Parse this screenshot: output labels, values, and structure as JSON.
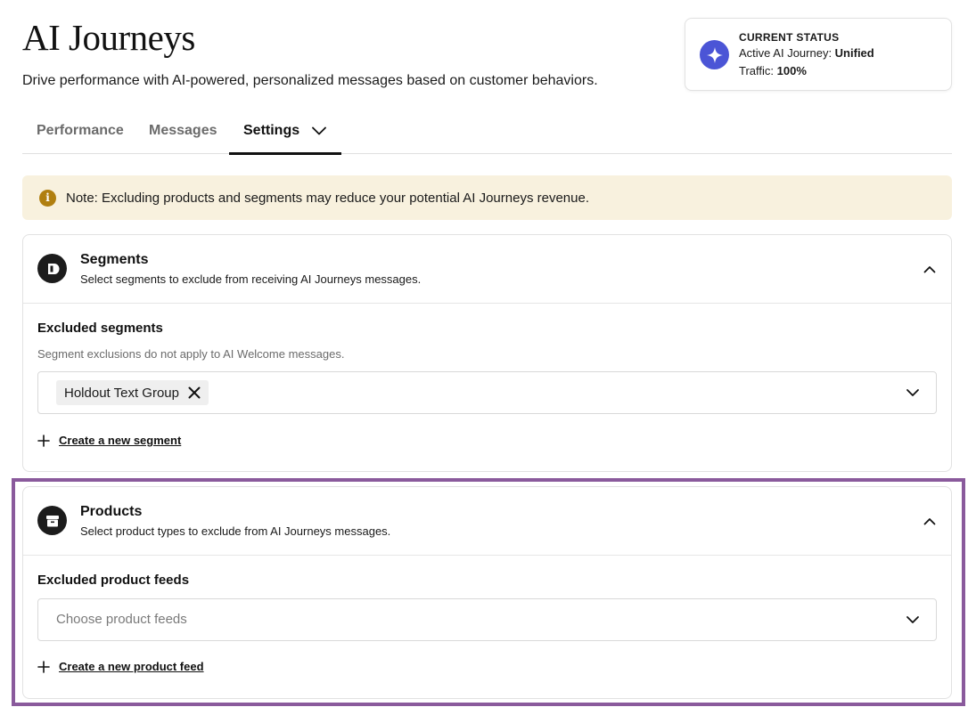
{
  "header": {
    "title": "AI Journeys",
    "subtitle": "Drive performance with AI-powered, personalized messages based on customer behaviors."
  },
  "status": {
    "label": "CURRENT STATUS",
    "journey_prefix": "Active AI Journey: ",
    "journey_value": "Unified",
    "traffic_prefix": "Traffic: ",
    "traffic_value": "100%",
    "icon": "sparkle-icon",
    "accent": "#4b55d6"
  },
  "tabs": [
    {
      "label": "Performance",
      "active": false
    },
    {
      "label": "Messages",
      "active": false
    },
    {
      "label": "Settings",
      "active": true
    }
  ],
  "note": {
    "icon_glyph": "i",
    "text": "Note: Excluding products and segments may reduce your potential AI Journeys revenue.",
    "background": "#f8f1de"
  },
  "segments": {
    "title": "Segments",
    "description": "Select segments to exclude from receiving AI Journeys messages.",
    "field_label": "Excluded segments",
    "help": "Segment exclusions do not apply to AI Welcome messages.",
    "selected": [
      "Holdout Text Group"
    ],
    "create_link": "Create a new segment"
  },
  "products": {
    "title": "Products",
    "description": "Select product types to exclude from AI Journeys messages.",
    "field_label": "Excluded product feeds",
    "placeholder": "Choose product feeds",
    "create_link": "Create a new product feed"
  },
  "highlight_color": "#8a5a9c"
}
